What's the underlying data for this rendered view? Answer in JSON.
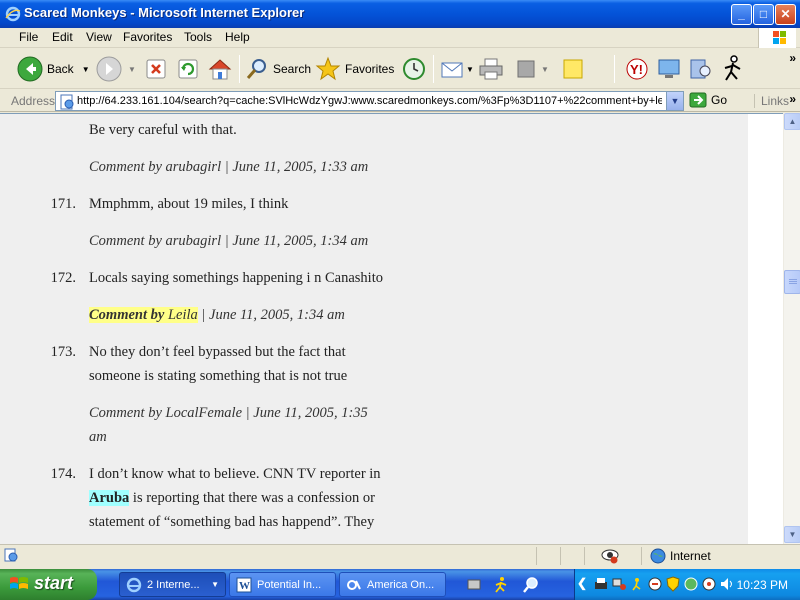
{
  "window": {
    "title": "Scared Monkeys - Microsoft Internet Explorer",
    "buttons": {
      "minimize": "_",
      "maximize": "□",
      "close": "✕"
    }
  },
  "menu": [
    "File",
    "Edit",
    "View",
    "Favorites",
    "Tools",
    "Help"
  ],
  "toolbar": {
    "back_label": "Back",
    "search_label": "Search",
    "favorites_label": "Favorites"
  },
  "address": {
    "label": "Address",
    "url": "http://64.233.161.104/search?q=cache:SVlHcWdzYgwJ:www.scaredmonkeys.com/%3Fp%3D1107+%22comment+by+le",
    "go_label": "Go",
    "links_label": "Links"
  },
  "comments": [
    {
      "number": "",
      "text_lines": [
        "Be very careful with that."
      ],
      "author_prefix": "Comment by ",
      "author": "arubagirl",
      "date_lines": [
        " | June 11, 2005, 1:33 am"
      ]
    },
    {
      "number": "171.",
      "text_lines": [
        "Mmphmm, about 19 miles, I think"
      ],
      "author_prefix": "Comment by ",
      "author": "arubagirl",
      "date_lines": [
        " | June 11, 2005, 1:34 am"
      ]
    },
    {
      "number": "172.",
      "text_lines": [
        "Locals saying somethings happening i n Canashito"
      ],
      "author_prefix": "Comment by ",
      "author": "Leila",
      "date_lines": [
        " | June 11, 2005, 1:34 am"
      ],
      "highlight": true
    },
    {
      "number": "173.",
      "text_lines": [
        "No they don’t feel bypassed but the fact that",
        "someone is stating something that is not true"
      ],
      "author_prefix": "Comment by ",
      "author": "LocalFemale",
      "date_lines": [
        " | June 11, 2005, 1:35",
        "am"
      ]
    },
    {
      "number": "174.",
      "text_lines": [
        "I don’t know what to believe. CNN TV reporter in",
        " is reporting that there was a confession or",
        "statement of “something bad has happend”. They"
      ],
      "keyword": "Aruba"
    }
  ],
  "status": {
    "zone": "Internet"
  },
  "taskbar": {
    "start_label": "start",
    "tasks": [
      {
        "label": "2 Interne...",
        "has_arrow": true
      },
      {
        "label": "Potential In..."
      },
      {
        "label": "America On..."
      }
    ],
    "clock": "10:23 PM"
  },
  "colors": {
    "highlight_yellow": "#FFFF88",
    "highlight_cyan": "#A0FFFF",
    "page_background": "#EFEFEF"
  }
}
